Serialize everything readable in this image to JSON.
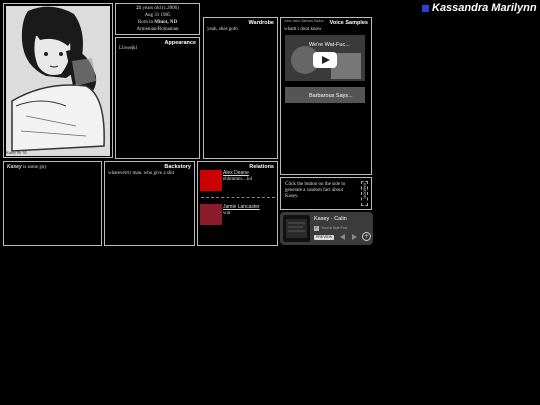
{
  "title": "Kassandra Marilynn",
  "basic": {
    "age_num": "21",
    "age_rest": "years old (c.2006)",
    "birthday": "Aug 31 1985",
    "born_prefix": "Born in",
    "born_place": "Minot, ND",
    "ethnicity": "Armenian/Romanian"
  },
  "portrait_caption": "Kasey 06 '05",
  "appearance": {
    "header": "Appearance",
    "text": "Llowejkl"
  },
  "wardrobe": {
    "header": "Wardrobe",
    "text": "yeah, shes goth"
  },
  "voice": {
    "tags": "voice claim: Barbara Santos",
    "header": "Voice Samples",
    "text": "whattt i dont know",
    "video1_title": "We're Wat-Fuc...",
    "video2_title": "Barbarous Says..."
  },
  "bio": {
    "name": "Kasey",
    "text": "is some guy"
  },
  "backstory": {
    "header": "Backstory",
    "text": "whateverrrr man. who give a shit"
  },
  "relations": {
    "header": "Relations",
    "items": [
      {
        "name": "Alex Deane",
        "note": "ehhmmm....lol",
        "color": "#cc0000"
      },
      {
        "name": "Jamie Lancaster",
        "note": "wut",
        "color": "#8b1a2a"
      }
    ]
  },
  "fact": {
    "text": "Click the button on the side to generate a random fact about Kasey.",
    "button": "RANDOM"
  },
  "music": {
    "artist": "Kasey",
    "separator": "·",
    "track": "Calin",
    "sub": "You're Not Fun",
    "preview": "PREVIEW",
    "badge": "E"
  },
  "colors": {
    "accent": "#2a3fd6",
    "relation1": "#cc0000",
    "relation2": "#8b1a2a"
  }
}
